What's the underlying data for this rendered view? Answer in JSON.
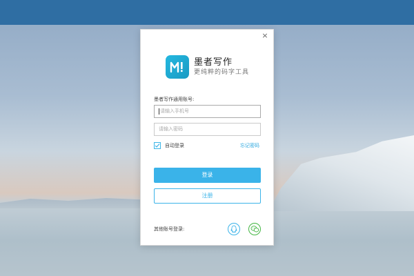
{
  "dialog": {
    "close_glyph": "×",
    "app_name": "墨者写作",
    "app_slogan": "更纯粹的码字工具",
    "account_label": "墨者写作通用账号:",
    "phone_placeholder": "请输入手机号",
    "password_placeholder": "请输入密码",
    "remember_label": "自动登录",
    "remember_checked": true,
    "forgot_label": "忘记密码",
    "login_label": "登录",
    "register_label": "注册",
    "other_login_label": "其他账号登录:"
  },
  "icons": {
    "logo": "app-logo-icon",
    "qq": "qq-icon",
    "wechat": "wechat-icon"
  },
  "colors": {
    "accent": "#3ab3e9",
    "wechat": "#41b541",
    "topbar": "#2f6ea3"
  }
}
